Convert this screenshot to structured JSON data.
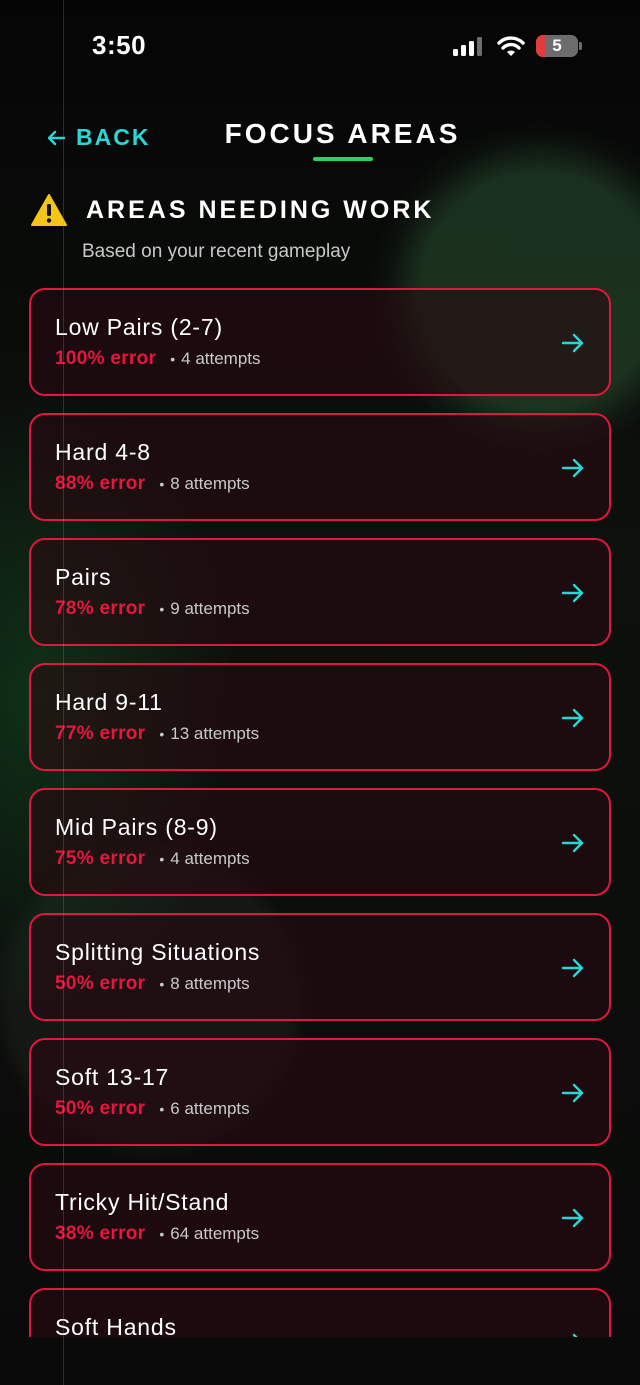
{
  "status_bar": {
    "time": "3:50",
    "battery_level": "5"
  },
  "header": {
    "back_label": "BACK",
    "title": "FOCUS AREAS"
  },
  "section": {
    "title": "AREAS NEEDING WORK",
    "subtitle": "Based on your recent gameplay",
    "icon": "warning-icon"
  },
  "colors": {
    "accent": "#28d7d5",
    "error": "#e8163f",
    "underline": "#1fd65f",
    "warning": "#f5c518"
  },
  "focus_areas": [
    {
      "name": "Low Pairs (2-7)",
      "error": "100% error",
      "attempts": "4 attempts"
    },
    {
      "name": "Hard 4-8",
      "error": "88% error",
      "attempts": "8 attempts"
    },
    {
      "name": "Pairs",
      "error": "78% error",
      "attempts": "9 attempts"
    },
    {
      "name": "Hard 9-11",
      "error": "77% error",
      "attempts": "13 attempts"
    },
    {
      "name": "Mid Pairs (8-9)",
      "error": "75% error",
      "attempts": "4 attempts"
    },
    {
      "name": "Splitting Situations",
      "error": "50% error",
      "attempts": "8 attempts"
    },
    {
      "name": "Soft 13-17",
      "error": "50% error",
      "attempts": "6 attempts"
    },
    {
      "name": "Tricky Hit/Stand",
      "error": "38% error",
      "attempts": "64 attempts"
    },
    {
      "name": "Soft Hands",
      "error": "",
      "attempts": ""
    }
  ]
}
